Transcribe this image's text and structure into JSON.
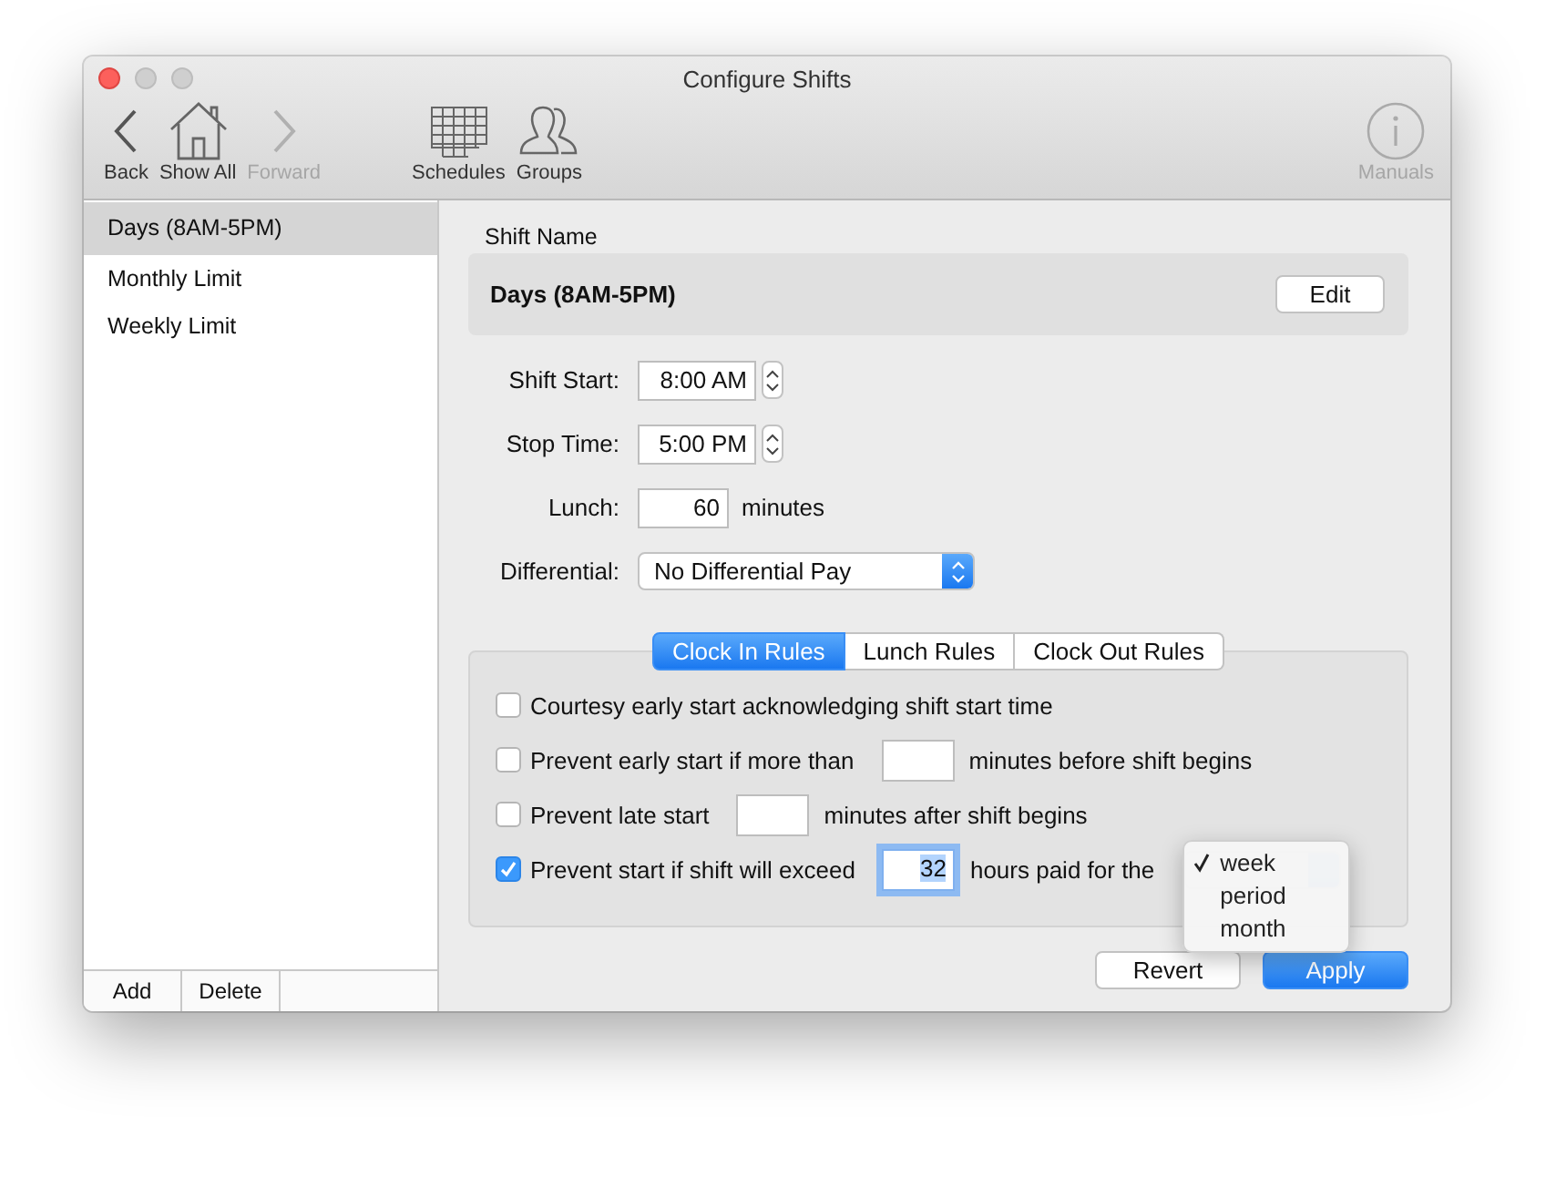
{
  "window": {
    "title": "Configure Shifts"
  },
  "toolbar": {
    "nav": [
      {
        "label": "Back",
        "disabled": false
      },
      {
        "label": "Show All",
        "disabled": false
      },
      {
        "label": "Forward",
        "disabled": true
      }
    ],
    "tools": [
      {
        "label": "Schedules",
        "disabled": false
      },
      {
        "label": "Groups",
        "disabled": false
      }
    ],
    "help": [
      {
        "label": "Manuals",
        "disabled": true
      }
    ]
  },
  "sidebar": {
    "items": [
      {
        "label": "Days (8AM-5PM)",
        "selected": true
      },
      {
        "label": "Monthly Limit",
        "selected": false
      },
      {
        "label": "Weekly Limit",
        "selected": false
      }
    ],
    "buttons": [
      "Add",
      "Delete"
    ]
  },
  "shift_name": {
    "label": "Shift Name",
    "value": "Days (8AM-5PM)",
    "button": "Edit"
  },
  "shift_start": {
    "label": "Shift Start:",
    "value": "8:00 AM"
  },
  "stop_time": {
    "label": "Stop Time:",
    "value": "5:00 PM"
  },
  "lunch": {
    "label": "Lunch:",
    "value": "60",
    "unit": "minutes"
  },
  "differential": {
    "label": "Differential:",
    "value": "No Differential Pay"
  },
  "rule_tabs": [
    {
      "label": "Clock In Rules",
      "selected": true
    },
    {
      "label": "Lunch Rules",
      "selected": false
    },
    {
      "label": "Clock Out Rules",
      "selected": false
    }
  ],
  "rules": [
    {
      "kind": "plain",
      "label": "Courtesy early start acknowledging shift start time",
      "checked": false
    },
    {
      "kind": "field",
      "label": "Prevent early start if more than",
      "checked": false,
      "field": {
        "focused": false
      },
      "suffix": "minutes before shift begins"
    },
    {
      "kind": "field",
      "label": "Prevent late start",
      "checked": false,
      "field": {
        "focused": false
      },
      "suffix": "minutes after shift begins"
    },
    {
      "kind": "field-menu",
      "label": "Prevent start if shift will exceed",
      "checked": true,
      "field": {
        "value": "32",
        "focused": true
      },
      "suffix": "hours paid for the",
      "menu": {
        "open": true,
        "options": [
          {
            "label": "week",
            "selected": true
          },
          {
            "label": "period",
            "selected": false
          },
          {
            "label": "month",
            "selected": false
          }
        ]
      }
    }
  ],
  "buttons": [
    {
      "label": "Revert",
      "default": false
    },
    {
      "label": "Apply",
      "default": true
    }
  ]
}
